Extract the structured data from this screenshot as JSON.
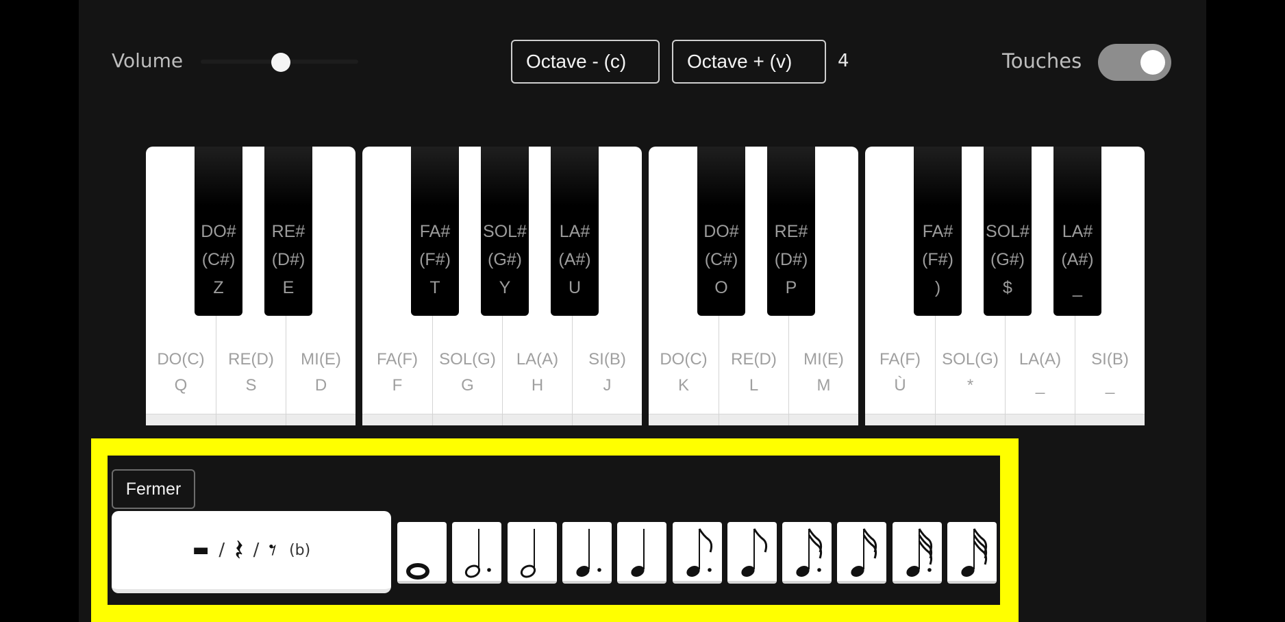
{
  "controls": {
    "volume_label": "Volume",
    "volume_level": 0.5,
    "octave_down_label": "Octave - (c)",
    "octave_up_label": "Octave + (v)",
    "octave_value": "4",
    "touches_label": "Touches",
    "touches_enabled": true
  },
  "white_keys": [
    {
      "note": "DO(C)",
      "key": "Q"
    },
    {
      "note": "RE(D)",
      "key": "S"
    },
    {
      "note": "MI(E)",
      "key": "D"
    },
    {
      "note": "FA(F)",
      "key": "F"
    },
    {
      "note": "SOL(G)",
      "key": "G"
    },
    {
      "note": "LA(A)",
      "key": "H"
    },
    {
      "note": "SI(B)",
      "key": "J"
    },
    {
      "note": "DO(C)",
      "key": "K"
    },
    {
      "note": "RE(D)",
      "key": "L"
    },
    {
      "note": "MI(E)",
      "key": "M"
    },
    {
      "note": "FA(F)",
      "key": "Ù"
    },
    {
      "note": "SOL(G)",
      "key": "*"
    },
    {
      "note": "LA(A)",
      "key": "_"
    },
    {
      "note": "SI(B)",
      "key": "_"
    }
  ],
  "black_keys": [
    {
      "note": "DO#",
      "alt": "(C#)",
      "key": "Z"
    },
    {
      "note": "RE#",
      "alt": "(D#)",
      "key": "E"
    },
    {
      "note": "FA#",
      "alt": "(F#)",
      "key": "T"
    },
    {
      "note": "SOL#",
      "alt": "(G#)",
      "key": "Y"
    },
    {
      "note": "LA#",
      "alt": "(A#)",
      "key": "U"
    },
    {
      "note": "DO#",
      "alt": "(C#)",
      "key": "O"
    },
    {
      "note": "RE#",
      "alt": "(D#)",
      "key": "P"
    },
    {
      "note": "FA#",
      "alt": "(F#)",
      "key": ")"
    },
    {
      "note": "SOL#",
      "alt": "(G#)",
      "key": "$"
    },
    {
      "note": "LA#",
      "alt": "(A#)",
      "key": "_"
    }
  ],
  "rhythm_panel": {
    "close_label": "Fermer",
    "rests": {
      "whole_rest": "▬",
      "sep1": "/",
      "quarter_rest": "𝄽",
      "sep2": "/",
      "eighth_rest": "𝄾",
      "key_hint": "(b)"
    },
    "durations": [
      "whole-note",
      "dotted-half-note",
      "half-note",
      "dotted-quarter-note",
      "quarter-note",
      "dotted-eighth-note",
      "eighth-note",
      "dotted-sixteenth-note",
      "sixteenth-note",
      "dotted-thirty-second-note",
      "thirty-second-note"
    ]
  },
  "colors": {
    "background": "#141414",
    "highlight": "#ffff00",
    "toggle_on": "#8d8d8d"
  }
}
